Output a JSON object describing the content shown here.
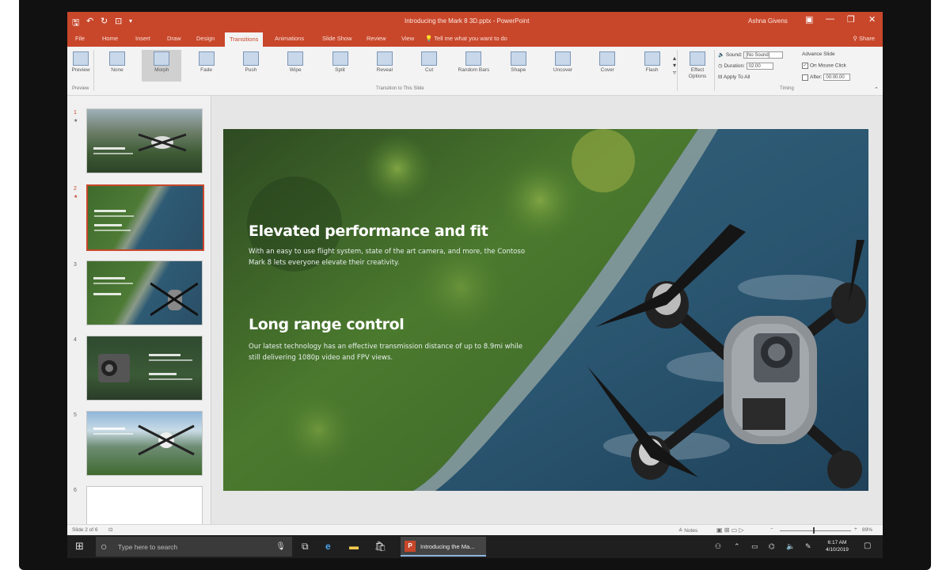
{
  "window": {
    "title": "Introducing the Mark 8 3D.pptx - PowerPoint",
    "user": "Ashna Givens",
    "controls": {
      "minimize": "—",
      "restore": "❐",
      "close": "✕"
    }
  },
  "quick_access": {
    "save": "🖫",
    "undo": "↶",
    "redo": "↻",
    "present": "⊡",
    "more": "▾"
  },
  "tabs": [
    "File",
    "Home",
    "Insert",
    "Draw",
    "Design",
    "Transitions",
    "Animations",
    "Slide Show",
    "Review",
    "View"
  ],
  "active_tab": "Transitions",
  "tell_me": "Tell me what you want to do",
  "share": "Share",
  "ribbon": {
    "preview_label": "Preview",
    "preview_group": "Preview",
    "transitions": [
      "None",
      "Morph",
      "Fade",
      "Push",
      "Wipe",
      "Split",
      "Reveal",
      "Cut",
      "Random Bars",
      "Shape",
      "Uncover",
      "Cover",
      "Flash"
    ],
    "selected_transition": "Morph",
    "transitions_group": "Transition to This Slide",
    "effect_options_label": "Effect Options",
    "timing": {
      "sound_label": "Sound:",
      "sound_value": "[No Sound]",
      "duration_label": "Duration:",
      "duration_value": "02.00",
      "apply_all": "Apply To All",
      "advance_label": "Advance Slide",
      "on_mouse_click": "On Mouse Click",
      "after_label": "After:",
      "after_value": "00:00.00",
      "group": "Timing"
    }
  },
  "thumbnails": [
    {
      "num": "1",
      "star": "★"
    },
    {
      "num": "2",
      "star": "★"
    },
    {
      "num": "3"
    },
    {
      "num": "4"
    },
    {
      "num": "5"
    },
    {
      "num": "6"
    }
  ],
  "selected_slide": 2,
  "slide": {
    "heading1": "Elevated performance and fit",
    "body1": "With an easy to use flight system, state of the art camera, and more, the Contoso Mark 8 lets everyone elevate their creativity.",
    "heading2": "Long range control",
    "body2": "Our latest technology has an effective transmission distance of up to 8.9mi while still delivering 1080p video and FPV views."
  },
  "status": {
    "slide_info": "Slide 2 of 6",
    "notes": "Notes",
    "zoom": "89%"
  },
  "taskbar": {
    "search_placeholder": "Type here to search",
    "ppt_window": "Introducing the Ma...",
    "time": "6:17 AM",
    "date": "4/10/2019"
  },
  "colors": {
    "accent": "#c8472b",
    "forest": "#3c6b2c",
    "water": "#2f5a73"
  }
}
